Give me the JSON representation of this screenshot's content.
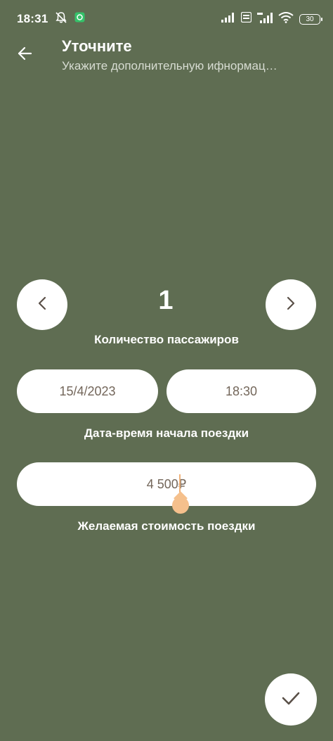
{
  "status_bar": {
    "time": "18:31",
    "battery": "30",
    "icons": [
      "notifications-off-icon",
      "app-badge-icon",
      "cellular-signal-icon",
      "volte-icon",
      "4g-signal-icon",
      "wifi-icon",
      "battery-icon"
    ]
  },
  "header": {
    "title": "Уточните",
    "subtitle": "Укажите дополнительную ифнормац…"
  },
  "passengers": {
    "count": "1",
    "caption": "Количество пассажиров"
  },
  "trip_start": {
    "date": "15/4/2023",
    "time": "18:30",
    "caption": "Дата-время начала поездки"
  },
  "price": {
    "value": "4 500₽",
    "caption": "Желаемая стоимость поездки"
  },
  "colors": {
    "background": "#5f6d52",
    "surface": "#ffffff",
    "pill_text": "#73665a",
    "cursor": "#f0b27a"
  }
}
